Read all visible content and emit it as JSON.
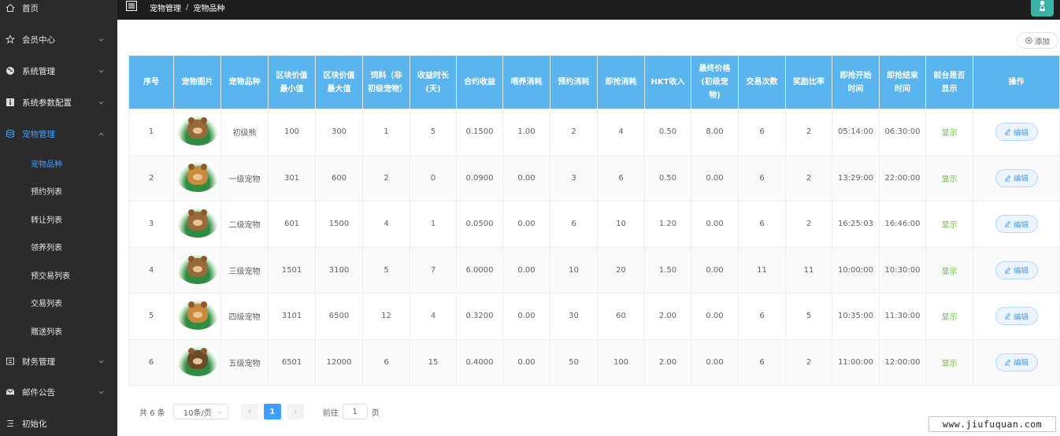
{
  "sidebar": {
    "items": [
      {
        "label": "首页",
        "icon": "home-icon",
        "expandable": false
      },
      {
        "label": "会员中心",
        "icon": "star-icon",
        "expandable": true
      },
      {
        "label": "系统管理",
        "icon": "globe-icon",
        "expandable": true
      },
      {
        "label": "系统参数配置",
        "icon": "info-icon",
        "expandable": true
      },
      {
        "label": "宠物管理",
        "icon": "database-icon",
        "expandable": true,
        "active": true
      },
      {
        "label": "财务管理",
        "icon": "finance-icon",
        "expandable": true
      },
      {
        "label": "邮件公告",
        "icon": "mail-icon",
        "expandable": true
      },
      {
        "label": "初始化",
        "icon": "list-icon",
        "expandable": false
      }
    ],
    "sub_items": [
      "宠物品种",
      "预约列表",
      "转让列表",
      "领养列表",
      "预交易列表",
      "交易列表",
      "赠送列表"
    ],
    "active_sub": "宠物品种"
  },
  "header": {
    "breadcrumb": [
      "宠物管理",
      "宠物品种"
    ]
  },
  "toolbar": {
    "add_label": "添加"
  },
  "table": {
    "columns": [
      "序号",
      "宠物图片",
      "宠物品种",
      "区块价值最小值",
      "区块价值最大值",
      "饲料（非初级宠物）",
      "收益时长(天)",
      "合约收益",
      "喂养消耗",
      "预约消耗",
      "即抢消耗",
      "HKT收入",
      "最终价格(初级宠物)",
      "交易次数",
      "奖励比率",
      "即抢开始时间",
      "即抢结束时间",
      "前台是否显示",
      "操作"
    ],
    "rows": [
      {
        "id": "1",
        "name": "初级熊",
        "min": "100",
        "max": "300",
        "feed": "1",
        "days": "5",
        "yield": "0.1500",
        "feed_cost": "1.00",
        "reserve_cost": "2",
        "grab_cost": "4",
        "hkt": "0.50",
        "final_price": "8.00",
        "trades": "6",
        "reward": "2",
        "start": "05:14:00",
        "end": "06:30:00",
        "show": "显示",
        "action": "编辑"
      },
      {
        "id": "2",
        "name": "一级宠物",
        "min": "301",
        "max": "600",
        "feed": "2",
        "days": "0",
        "yield": "0.0900",
        "feed_cost": "0.00",
        "reserve_cost": "3",
        "grab_cost": "6",
        "hkt": "0.50",
        "final_price": "0.00",
        "trades": "6",
        "reward": "2",
        "start": "13:29:00",
        "end": "22:00:00",
        "show": "显示",
        "action": "编辑"
      },
      {
        "id": "3",
        "name": "二级宠物",
        "min": "601",
        "max": "1500",
        "feed": "4",
        "days": "1",
        "yield": "0.0500",
        "feed_cost": "0.00",
        "reserve_cost": "6",
        "grab_cost": "10",
        "hkt": "1.20",
        "final_price": "0.00",
        "trades": "6",
        "reward": "2",
        "start": "16:25:03",
        "end": "16:46:00",
        "show": "显示",
        "action": "编辑"
      },
      {
        "id": "4",
        "name": "三级宠物",
        "min": "1501",
        "max": "3100",
        "feed": "5",
        "days": "7",
        "yield": "6.0000",
        "feed_cost": "0.00",
        "reserve_cost": "10",
        "grab_cost": "20",
        "hkt": "1.50",
        "final_price": "0.00",
        "trades": "11",
        "reward": "11",
        "start": "10:00:00",
        "end": "10:30:00",
        "show": "显示",
        "action": "编辑"
      },
      {
        "id": "5",
        "name": "四级宠物",
        "min": "3101",
        "max": "6500",
        "feed": "12",
        "days": "4",
        "yield": "0.3200",
        "feed_cost": "0.00",
        "reserve_cost": "30",
        "grab_cost": "60",
        "hkt": "2.00",
        "final_price": "0.00",
        "trades": "6",
        "reward": "5",
        "start": "10:35:00",
        "end": "11:30:00",
        "show": "显示",
        "action": "编辑"
      },
      {
        "id": "6",
        "name": "五级宠物",
        "min": "6501",
        "max": "12000",
        "feed": "6",
        "days": "15",
        "yield": "0.4000",
        "feed_cost": "0.00",
        "reserve_cost": "50",
        "grab_cost": "100",
        "hkt": "2.00",
        "final_price": "0.00",
        "trades": "6",
        "reward": "2",
        "start": "11:00:00",
        "end": "12:00:00",
        "show": "显示",
        "action": "编辑"
      }
    ]
  },
  "pagination": {
    "total": "共 6 条",
    "page_size": "10条/页",
    "current_page": "1",
    "goto_label": "前往",
    "goto_value": "1",
    "page_suffix": "页"
  },
  "watermark": "www.jiufuquan.com",
  "colors": {
    "sidebar_bg": "#2b2b2b",
    "header_bg": "#1e1e1e",
    "table_header_bg": "#5ab4ee",
    "accent": "#409eff",
    "success": "#67c23a"
  }
}
